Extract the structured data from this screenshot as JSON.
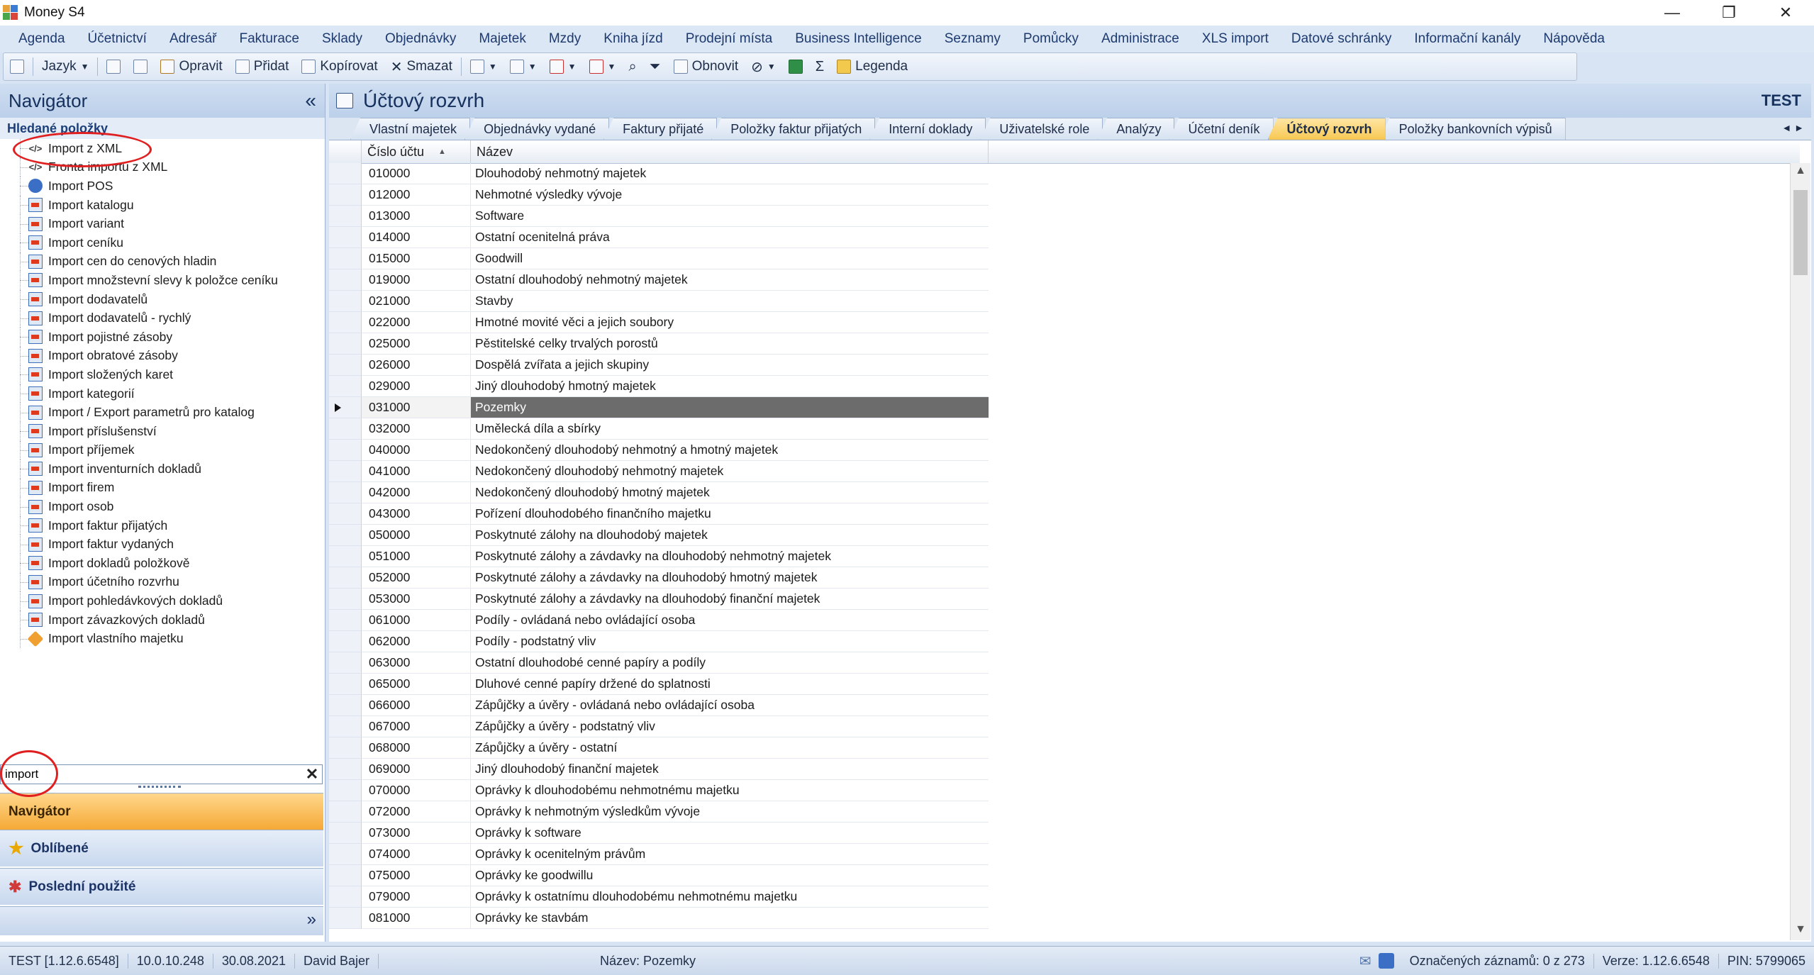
{
  "window": {
    "title": "Money S4",
    "controls": [
      "minimize",
      "restore",
      "close"
    ]
  },
  "menu": [
    "Agenda",
    "Účetnictví",
    "Adresář",
    "Fakturace",
    "Sklady",
    "Objednávky",
    "Majetek",
    "Mzdy",
    "Kniha jízd",
    "Prodejní místa",
    "Business Intelligence",
    "Seznamy",
    "Pomůcky",
    "Administrace",
    "XLS import",
    "Datové schránky",
    "Informační kanály",
    "Nápověda"
  ],
  "toolbar": {
    "language": "Jazyk",
    "edit": "Opravit",
    "add": "Přidat",
    "copy": "Kopírovat",
    "delete": "Smazat",
    "refresh": "Obnovit",
    "legend": "Legenda"
  },
  "navigator": {
    "title": "Navigátor",
    "collapse": "«",
    "subheader": "Hledané položky",
    "items": [
      {
        "label": "Import z XML",
        "icon": "xml-icon"
      },
      {
        "label": "Fronta importu z XML",
        "icon": "xml-icon"
      },
      {
        "label": "Import POS",
        "icon": "pos-icon"
      },
      {
        "label": "Import katalogu",
        "icon": "import-icon"
      },
      {
        "label": "Import variant",
        "icon": "import-icon"
      },
      {
        "label": "Import ceníku",
        "icon": "import-icon"
      },
      {
        "label": "Import cen do cenových hladin",
        "icon": "import-icon"
      },
      {
        "label": "Import množstevní slevy k položce ceníku",
        "icon": "import-icon"
      },
      {
        "label": "Import dodavatelů",
        "icon": "import-icon"
      },
      {
        "label": "Import dodavatelů - rychlý",
        "icon": "import-icon"
      },
      {
        "label": "Import pojistné zásoby",
        "icon": "import-icon"
      },
      {
        "label": "Import obratové zásoby",
        "icon": "import-icon"
      },
      {
        "label": "Import složených karet",
        "icon": "import-icon"
      },
      {
        "label": "Import kategorií",
        "icon": "import-icon"
      },
      {
        "label": "Import / Export parametrů pro katalog",
        "icon": "import-icon"
      },
      {
        "label": "Import příslušenství",
        "icon": "import-icon"
      },
      {
        "label": "Import příjemek",
        "icon": "import-icon"
      },
      {
        "label": "Import inventurních dokladů",
        "icon": "import-icon"
      },
      {
        "label": "Import firem",
        "icon": "import-icon"
      },
      {
        "label": "Import osob",
        "icon": "import-icon"
      },
      {
        "label": "Import faktur přijatých",
        "icon": "import-icon"
      },
      {
        "label": "Import faktur vydaných",
        "icon": "import-icon"
      },
      {
        "label": "Import dokladů položkově",
        "icon": "import-icon"
      },
      {
        "label": "Import účetního rozvrhu",
        "icon": "import-icon"
      },
      {
        "label": "Import pohledávkových dokladů",
        "icon": "import-icon"
      },
      {
        "label": "Import závazkových dokladů",
        "icon": "import-icon"
      },
      {
        "label": "Import vlastního majetku",
        "icon": "asset-icon"
      }
    ],
    "search_value": "import",
    "clear": "✕",
    "buttons": {
      "navigator": "Navigátor",
      "favorites": "Oblíbené",
      "recent": "Poslední použité"
    },
    "more": "»"
  },
  "content": {
    "title": "Účtový rozvrh",
    "db": "TEST",
    "tabs": [
      "Vlastní majetek",
      "Objednávky vydané",
      "Faktury přijaté",
      "Položky faktur přijatých",
      "Interní doklady",
      "Uživatelské role",
      "Analýzy",
      "Účetní deník",
      "Účtový rozvrh",
      "Položky bankovních výpisů"
    ],
    "active_tab": "Účtový rozvrh",
    "columns": {
      "account": "Číslo účtu",
      "name": "Název"
    },
    "sort_indicator": "▲",
    "selected_account": "031000",
    "rows": [
      {
        "account": "010000",
        "name": "Dlouhodobý nehmotný majetek"
      },
      {
        "account": "012000",
        "name": "Nehmotné výsledky vývoje"
      },
      {
        "account": "013000",
        "name": "Software"
      },
      {
        "account": "014000",
        "name": "Ostatní ocenitelná práva"
      },
      {
        "account": "015000",
        "name": "Goodwill"
      },
      {
        "account": "019000",
        "name": "Ostatní dlouhodobý nehmotný majetek"
      },
      {
        "account": "021000",
        "name": "Stavby"
      },
      {
        "account": "022000",
        "name": "Hmotné movité věci a jejich soubory"
      },
      {
        "account": "025000",
        "name": "Pěstitelské celky trvalých porostů"
      },
      {
        "account": "026000",
        "name": "Dospělá zvířata a jejich skupiny"
      },
      {
        "account": "029000",
        "name": "Jiný dlouhodobý hmotný majetek"
      },
      {
        "account": "031000",
        "name": "Pozemky"
      },
      {
        "account": "032000",
        "name": "Umělecká díla a sbírky"
      },
      {
        "account": "040000",
        "name": "Nedokončený dlouhodobý nehmotný a hmotný majetek"
      },
      {
        "account": "041000",
        "name": "Nedokončený dlouhodobý nehmotný majetek"
      },
      {
        "account": "042000",
        "name": "Nedokončený dlouhodobý hmotný majetek"
      },
      {
        "account": "043000",
        "name": "Pořízení dlouhodobého finančního majetku"
      },
      {
        "account": "050000",
        "name": "Poskytnuté zálohy na dlouhodobý majetek"
      },
      {
        "account": "051000",
        "name": "Poskytnuté zálohy a závdavky na dlouhodobý nehmotný majetek"
      },
      {
        "account": "052000",
        "name": "Poskytnuté zálohy a závdavky na dlouhodobý hmotný majetek"
      },
      {
        "account": "053000",
        "name": "Poskytnuté zálohy a závdavky na dlouhodobý finanční majetek"
      },
      {
        "account": "061000",
        "name": "Podíly - ovládaná nebo ovládající osoba"
      },
      {
        "account": "062000",
        "name": "Podíly - podstatný vliv"
      },
      {
        "account": "063000",
        "name": "Ostatní dlouhodobé cenné papíry a podíly"
      },
      {
        "account": "065000",
        "name": "Dluhové cenné papíry držené do splatnosti"
      },
      {
        "account": "066000",
        "name": "Zápůjčky a úvěry - ovládaná nebo ovládající osoba"
      },
      {
        "account": "067000",
        "name": "Zápůjčky a úvěry - podstatný vliv"
      },
      {
        "account": "068000",
        "name": "Zápůjčky a úvěry - ostatní"
      },
      {
        "account": "069000",
        "name": "Jiný dlouhodobý finanční majetek"
      },
      {
        "account": "070000",
        "name": "Oprávky k dlouhodobému nehmotnému majetku"
      },
      {
        "account": "072000",
        "name": "Oprávky k nehmotným výsledkům vývoje"
      },
      {
        "account": "073000",
        "name": "Oprávky k software"
      },
      {
        "account": "074000",
        "name": "Oprávky k ocenitelným právům"
      },
      {
        "account": "075000",
        "name": "Oprávky ke goodwillu"
      },
      {
        "account": "079000",
        "name": "Oprávky k ostatnímu dlouhodobému nehmotnému majetku"
      },
      {
        "account": "081000",
        "name": "Oprávky ke stavbám"
      }
    ]
  },
  "status": {
    "db": "TEST [1.12.6.6548]",
    "ip": "10.0.10.248",
    "date": "30.08.2021",
    "user": "David Bajer",
    "selected_name": "Název: Pozemky",
    "marked": "Označených záznamů: 0 z 273",
    "version": "Verze: 1.12.6.6548",
    "pin": "PIN: 5799065"
  },
  "colors": {
    "menu_text": "#1d3a6e",
    "active_tab": "#f7c752",
    "selected_row": "#6c6c6c",
    "annotation": "#e02020"
  }
}
